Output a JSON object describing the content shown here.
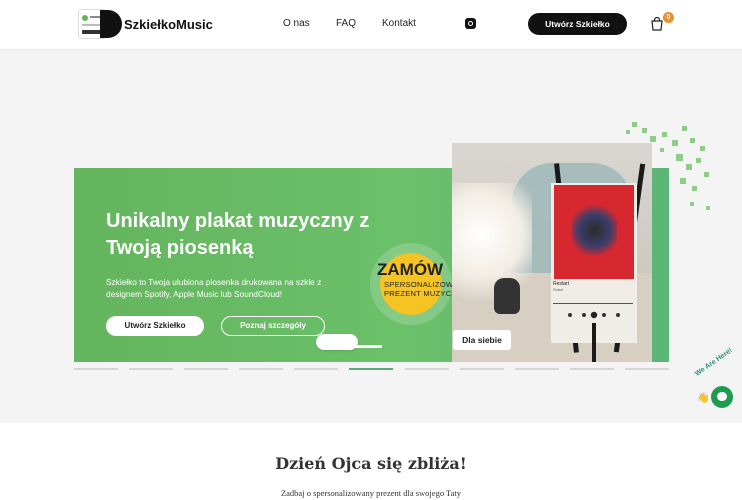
{
  "header": {
    "logo_text": "SzkiełkoMusic",
    "nav": [
      {
        "label": "O nas"
      },
      {
        "label": "FAQ"
      },
      {
        "label": "Kontakt"
      }
    ],
    "cta_label": "Utwórz Szkiełko",
    "cart_count": "0",
    "icons": {
      "social": "instagram-icon",
      "cart": "shopping-bag-icon"
    }
  },
  "hero": {
    "title": "Unikalny plakat muzyczny z Twoją piosenką",
    "description": "Szkiełko to Twoja ulubiona piosenka drukowana na szkle z designem Spotify, Apple Music lub SoundCloud!",
    "primary_button": "Utwórz Szkiełko",
    "secondary_button": "Poznaj szczegóły",
    "badge_big": "ZAMÓW",
    "badge_small": "SPERSONALIZOWANY PREZENT MUZYCZNY",
    "photo_label": "Dla siebie",
    "poster_song": "Restart",
    "poster_artist": "Sobel",
    "colors": {
      "green": "#64b55d",
      "badge": "#f5c323"
    }
  },
  "carousel": {
    "count": 11,
    "active_index": 5
  },
  "section": {
    "title": "Dzień Ojca się zbliża!",
    "subtitle": "Zadbaj o spersonalizowany prezent dla swojego Taty"
  },
  "chat": {
    "label": "We Are Here!"
  }
}
